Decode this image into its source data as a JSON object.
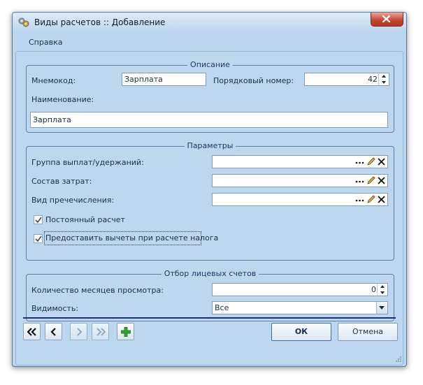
{
  "window": {
    "title": "Виды расчетов :: Добавление"
  },
  "menu": {
    "help": "Справка"
  },
  "description": {
    "legend": "Описание",
    "mnemo_label": "Мнемокод:",
    "mnemo_value": "Зарплата",
    "order_label": "Порядковый номер:",
    "order_value": "42",
    "name_label": "Наименование:",
    "name_value": "Зарплата"
  },
  "parameters": {
    "legend": "Параметры",
    "group_label": "Группа выплат/удержаний:",
    "cost_label": "Состав затрат:",
    "transfer_label": "Вид пречечисления:",
    "constant_label": "Постоянный расчет",
    "constant_checked": true,
    "deduction_label": "Предоставить вычеты при расчете налога",
    "deduction_checked": true
  },
  "accounts": {
    "legend": "Отбор лицевых счетов",
    "months_label": "Количество месяцев просмотра:",
    "months_value": "0",
    "visibility_label": "Видимость:",
    "visibility_value": "Все"
  },
  "buttons": {
    "ok": "ОК",
    "cancel": "Отмена"
  },
  "icons": {
    "app": "gears-icon",
    "close": "close-icon",
    "ellipsis": "ellipsis-icon",
    "edit": "pencil-icon",
    "clear": "clear-x-icon",
    "first": "first-record-icon",
    "prev": "prev-record-icon",
    "next": "next-record-icon",
    "last": "last-record-icon",
    "add": "add-plus-icon"
  },
  "colors": {
    "window_bg": "#bcd6ef",
    "accent": "#1c2f7a",
    "add_green": "#2fa52f",
    "close_red": "#c44a34"
  }
}
